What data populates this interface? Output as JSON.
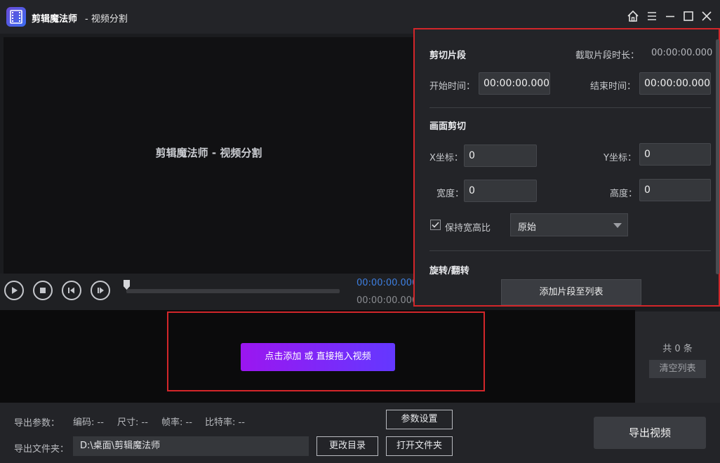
{
  "app": {
    "title": "剪辑魔法师",
    "subtitle": "- 视频分割"
  },
  "window_controls": {
    "home": "home-icon",
    "menu": "menu-icon",
    "minimize": "minimize-icon",
    "maximize": "maximize-icon",
    "close": "close-icon"
  },
  "preview": {
    "placeholder_text": "剪辑魔法师 - 视频分割"
  },
  "player": {
    "time_current": "00:00:00.000",
    "time_total": "00:00:00.000",
    "progress": 0
  },
  "settings": {
    "cut_segment": {
      "title": "剪切片段",
      "duration_label": "截取片段时长：",
      "duration_value": "00:00:00.000",
      "start_label": "开始时间：",
      "start_value": "00:00:00.000",
      "end_label": "结束时间：",
      "end_value": "00:00:00.000"
    },
    "crop": {
      "title": "画面剪切",
      "x_label": "X坐标：",
      "x_value": "0",
      "y_label": "Y坐标：",
      "y_value": "0",
      "width_label": "宽度：",
      "width_value": "0",
      "height_label": "高度：",
      "height_value": "0",
      "keep_ratio_label": "保持宽高比",
      "keep_ratio_checked": true,
      "ratio_selected": "原始"
    },
    "rotate": {
      "title": "旋转/翻转"
    },
    "add_segment_label": "添加片段至列表"
  },
  "drop_zone": {
    "add_button_label": "点击添加 或 直接拖入视频"
  },
  "list_panel": {
    "count_text": "共 0 条",
    "clear_label": "清空列表"
  },
  "bottom": {
    "params_label": "导出参数：",
    "codec": "编码: --",
    "size": "尺寸: --",
    "framerate": "帧率: --",
    "bitrate": "比特率: --",
    "param_settings_label": "参数设置",
    "folder_label": "导出文件夹：",
    "folder_path": "D:\\桌面\\剪辑魔法师",
    "change_dir_label": "更改目录",
    "open_folder_label": "打开文件夹",
    "export_label": "导出视频"
  },
  "colors": {
    "accent_blue": "#3d7ee0",
    "highlight_red": "#d3262a",
    "add_button_start": "#9b16f0",
    "add_button_end": "#6438ff"
  }
}
